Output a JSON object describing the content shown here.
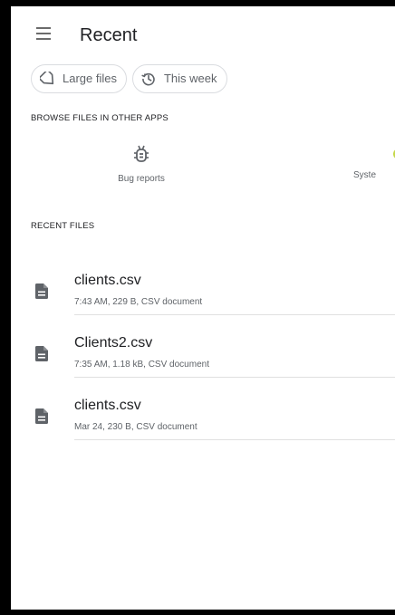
{
  "appbar": {
    "title": "Recent",
    "menu_icon": "hamburger-menu-icon"
  },
  "chips": [
    {
      "label": "Large files",
      "icon": "tag-icon"
    },
    {
      "label": "This week",
      "icon": "history-icon"
    }
  ],
  "browse_section": {
    "label": "BROWSE FILES IN OTHER APPS",
    "apps": [
      {
        "label": "Bug reports",
        "icon": "bug-icon"
      },
      {
        "label": "Syste",
        "icon": "system-app-icon",
        "accent": "#c6d84a"
      }
    ]
  },
  "recent_section": {
    "label": "RECENT FILES"
  },
  "files": [
    {
      "name": "clients.csv",
      "meta": "7:43 AM, 229 B, CSV document",
      "icon": "document-icon"
    },
    {
      "name": "Clients2.csv",
      "meta": "7:35 AM, 1.18 kB, CSV document",
      "icon": "document-icon"
    },
    {
      "name": "clients.csv",
      "meta": "Mar 24, 230 B, CSV document",
      "icon": "document-icon"
    }
  ],
  "colors": {
    "frame": "#000000",
    "surface": "#ffffff",
    "text_primary": "#202124",
    "text_secondary": "#5f6368",
    "icon": "#5f6368",
    "divider": "#e0e0e0"
  }
}
